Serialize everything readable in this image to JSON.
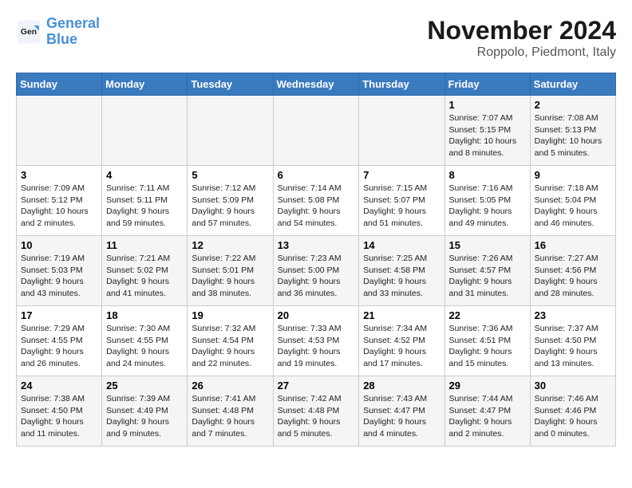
{
  "logo": {
    "line1": "General",
    "line2": "Blue"
  },
  "title": "November 2024",
  "location": "Roppolo, Piedmont, Italy",
  "weekdays": [
    "Sunday",
    "Monday",
    "Tuesday",
    "Wednesday",
    "Thursday",
    "Friday",
    "Saturday"
  ],
  "weeks": [
    [
      {
        "day": "",
        "info": ""
      },
      {
        "day": "",
        "info": ""
      },
      {
        "day": "",
        "info": ""
      },
      {
        "day": "",
        "info": ""
      },
      {
        "day": "",
        "info": ""
      },
      {
        "day": "1",
        "info": "Sunrise: 7:07 AM\nSunset: 5:15 PM\nDaylight: 10 hours\nand 8 minutes."
      },
      {
        "day": "2",
        "info": "Sunrise: 7:08 AM\nSunset: 5:13 PM\nDaylight: 10 hours\nand 5 minutes."
      }
    ],
    [
      {
        "day": "3",
        "info": "Sunrise: 7:09 AM\nSunset: 5:12 PM\nDaylight: 10 hours\nand 2 minutes."
      },
      {
        "day": "4",
        "info": "Sunrise: 7:11 AM\nSunset: 5:11 PM\nDaylight: 9 hours\nand 59 minutes."
      },
      {
        "day": "5",
        "info": "Sunrise: 7:12 AM\nSunset: 5:09 PM\nDaylight: 9 hours\nand 57 minutes."
      },
      {
        "day": "6",
        "info": "Sunrise: 7:14 AM\nSunset: 5:08 PM\nDaylight: 9 hours\nand 54 minutes."
      },
      {
        "day": "7",
        "info": "Sunrise: 7:15 AM\nSunset: 5:07 PM\nDaylight: 9 hours\nand 51 minutes."
      },
      {
        "day": "8",
        "info": "Sunrise: 7:16 AM\nSunset: 5:05 PM\nDaylight: 9 hours\nand 49 minutes."
      },
      {
        "day": "9",
        "info": "Sunrise: 7:18 AM\nSunset: 5:04 PM\nDaylight: 9 hours\nand 46 minutes."
      }
    ],
    [
      {
        "day": "10",
        "info": "Sunrise: 7:19 AM\nSunset: 5:03 PM\nDaylight: 9 hours\nand 43 minutes."
      },
      {
        "day": "11",
        "info": "Sunrise: 7:21 AM\nSunset: 5:02 PM\nDaylight: 9 hours\nand 41 minutes."
      },
      {
        "day": "12",
        "info": "Sunrise: 7:22 AM\nSunset: 5:01 PM\nDaylight: 9 hours\nand 38 minutes."
      },
      {
        "day": "13",
        "info": "Sunrise: 7:23 AM\nSunset: 5:00 PM\nDaylight: 9 hours\nand 36 minutes."
      },
      {
        "day": "14",
        "info": "Sunrise: 7:25 AM\nSunset: 4:58 PM\nDaylight: 9 hours\nand 33 minutes."
      },
      {
        "day": "15",
        "info": "Sunrise: 7:26 AM\nSunset: 4:57 PM\nDaylight: 9 hours\nand 31 minutes."
      },
      {
        "day": "16",
        "info": "Sunrise: 7:27 AM\nSunset: 4:56 PM\nDaylight: 9 hours\nand 28 minutes."
      }
    ],
    [
      {
        "day": "17",
        "info": "Sunrise: 7:29 AM\nSunset: 4:55 PM\nDaylight: 9 hours\nand 26 minutes."
      },
      {
        "day": "18",
        "info": "Sunrise: 7:30 AM\nSunset: 4:55 PM\nDaylight: 9 hours\nand 24 minutes."
      },
      {
        "day": "19",
        "info": "Sunrise: 7:32 AM\nSunset: 4:54 PM\nDaylight: 9 hours\nand 22 minutes."
      },
      {
        "day": "20",
        "info": "Sunrise: 7:33 AM\nSunset: 4:53 PM\nDaylight: 9 hours\nand 19 minutes."
      },
      {
        "day": "21",
        "info": "Sunrise: 7:34 AM\nSunset: 4:52 PM\nDaylight: 9 hours\nand 17 minutes."
      },
      {
        "day": "22",
        "info": "Sunrise: 7:36 AM\nSunset: 4:51 PM\nDaylight: 9 hours\nand 15 minutes."
      },
      {
        "day": "23",
        "info": "Sunrise: 7:37 AM\nSunset: 4:50 PM\nDaylight: 9 hours\nand 13 minutes."
      }
    ],
    [
      {
        "day": "24",
        "info": "Sunrise: 7:38 AM\nSunset: 4:50 PM\nDaylight: 9 hours\nand 11 minutes."
      },
      {
        "day": "25",
        "info": "Sunrise: 7:39 AM\nSunset: 4:49 PM\nDaylight: 9 hours\nand 9 minutes."
      },
      {
        "day": "26",
        "info": "Sunrise: 7:41 AM\nSunset: 4:48 PM\nDaylight: 9 hours\nand 7 minutes."
      },
      {
        "day": "27",
        "info": "Sunrise: 7:42 AM\nSunset: 4:48 PM\nDaylight: 9 hours\nand 5 minutes."
      },
      {
        "day": "28",
        "info": "Sunrise: 7:43 AM\nSunset: 4:47 PM\nDaylight: 9 hours\nand 4 minutes."
      },
      {
        "day": "29",
        "info": "Sunrise: 7:44 AM\nSunset: 4:47 PM\nDaylight: 9 hours\nand 2 minutes."
      },
      {
        "day": "30",
        "info": "Sunrise: 7:46 AM\nSunset: 4:46 PM\nDaylight: 9 hours\nand 0 minutes."
      }
    ]
  ]
}
